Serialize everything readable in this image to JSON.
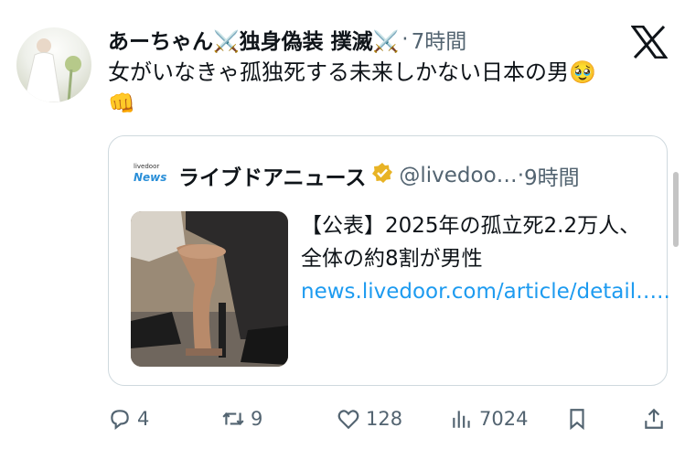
{
  "tweet": {
    "author_name": "あーちゃん⚔️独身偽装 撲滅⚔️",
    "separator": "·",
    "time": "7時間",
    "text": "女がいなきゃ孤独死する未来しかない日本の男",
    "emoji_1": "🥹",
    "emoji_2": "👊"
  },
  "quote": {
    "logo_small": "livedoor",
    "logo_main": "News",
    "name": "ライブドアニュース",
    "verified_badge": "🏅",
    "handle": "@livedoo…",
    "separator": "·",
    "time": "9時間",
    "text": "【公表】2025年の孤立死2.2万人、全体の約8割が男性",
    "link": "news.livedoor.com/article/detail….."
  },
  "actions": {
    "reply_count": "4",
    "retweet_count": "9",
    "like_count": "128",
    "view_count": "7024"
  },
  "colors": {
    "link": "#1d9bf0",
    "secondary_text": "#536471",
    "border": "#cfd9de"
  },
  "icons": [
    "x-logo-icon",
    "verified-badge-icon",
    "reply-icon",
    "retweet-icon",
    "like-icon",
    "views-icon",
    "bookmark-icon",
    "share-icon"
  ]
}
